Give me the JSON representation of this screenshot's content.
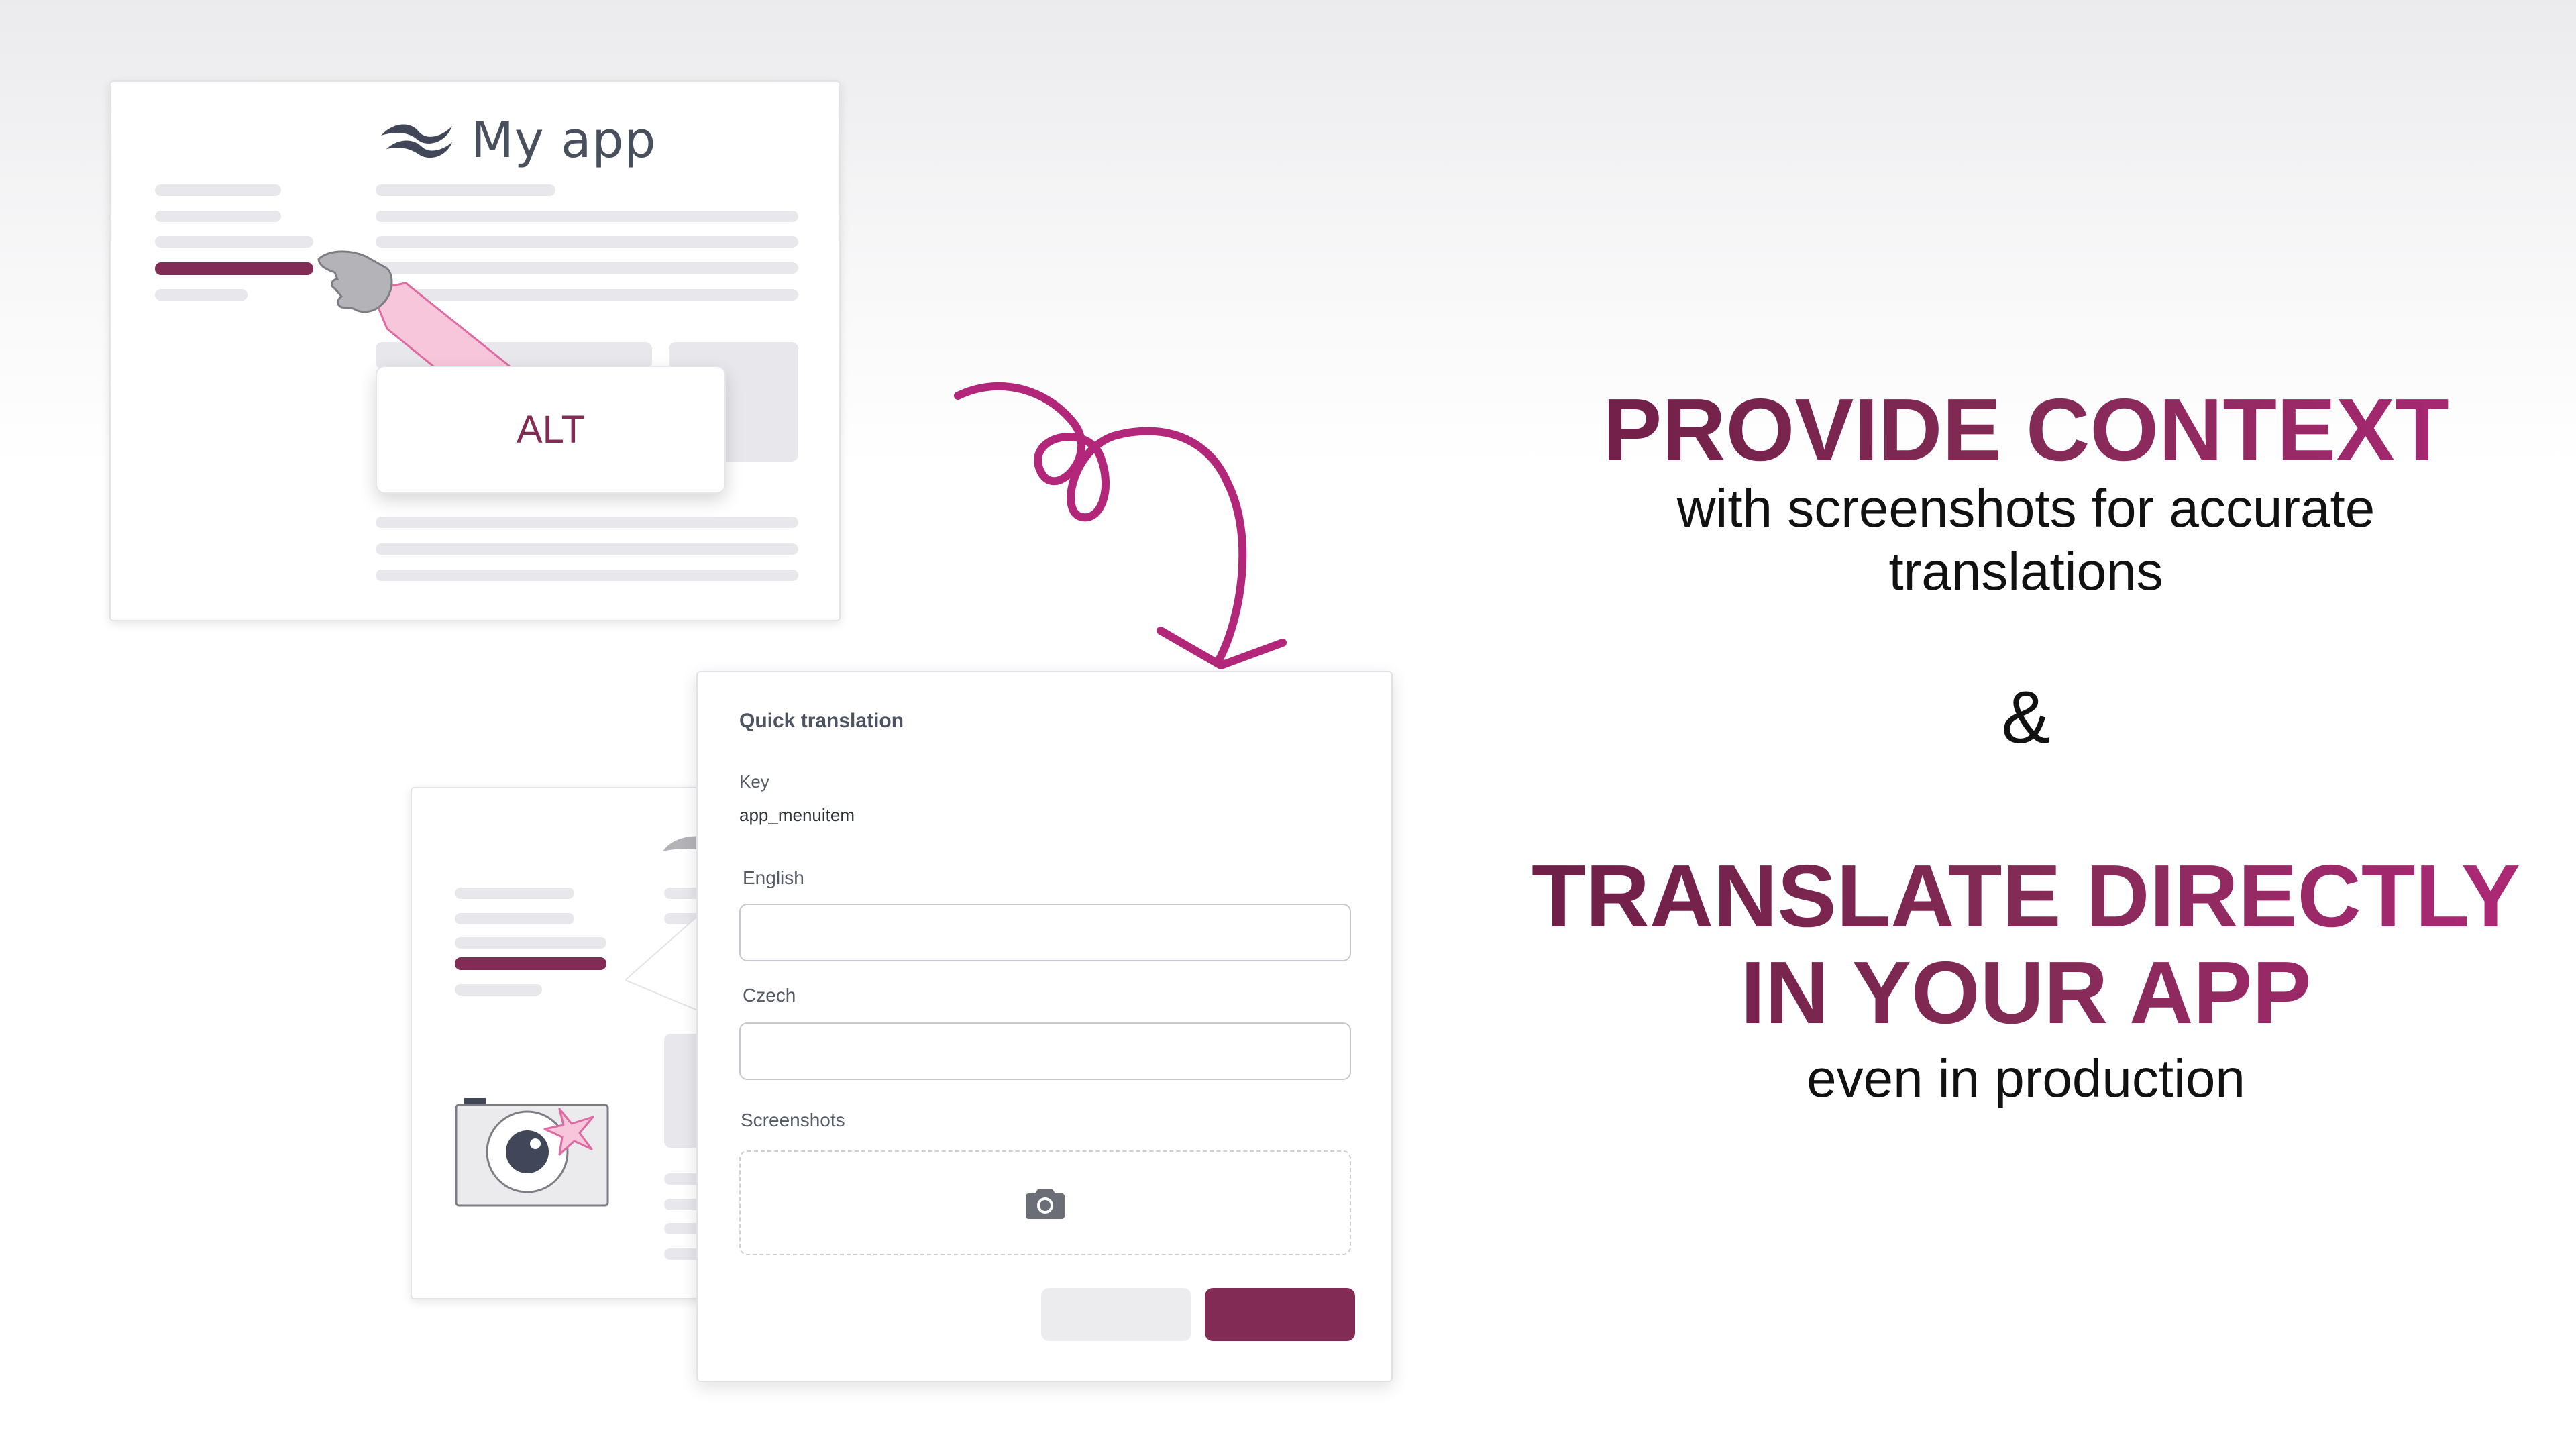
{
  "my_app": {
    "title": "My app",
    "alt_label": "ALT"
  },
  "dialog": {
    "title": "Quick translation",
    "key_label": "Key",
    "key_value": "app_menuitem",
    "english_label": "English",
    "english_value": "",
    "czech_label": "Czech",
    "czech_value": "",
    "screenshots_label": "Screenshots",
    "cancel_label": "",
    "save_label": ""
  },
  "headline1": {
    "title": "PROVIDE CONTEXT",
    "line1": "with screenshots for accurate",
    "line2": "translations"
  },
  "ampersand": "&",
  "headline2": {
    "line1": "TRANSLATE DIRECTLY",
    "line2": "IN YOUR APP",
    "sub": "even in production"
  },
  "colors": {
    "brand": "#822b55",
    "brand_light": "#b2277a",
    "arm_pink": "#f8c6da"
  },
  "icons": {
    "logo": "tolgee-wave-logo",
    "pointing_hand": "pointing-hand-icon",
    "camera": "camera-icon",
    "arrow": "curly-arrow-icon"
  }
}
